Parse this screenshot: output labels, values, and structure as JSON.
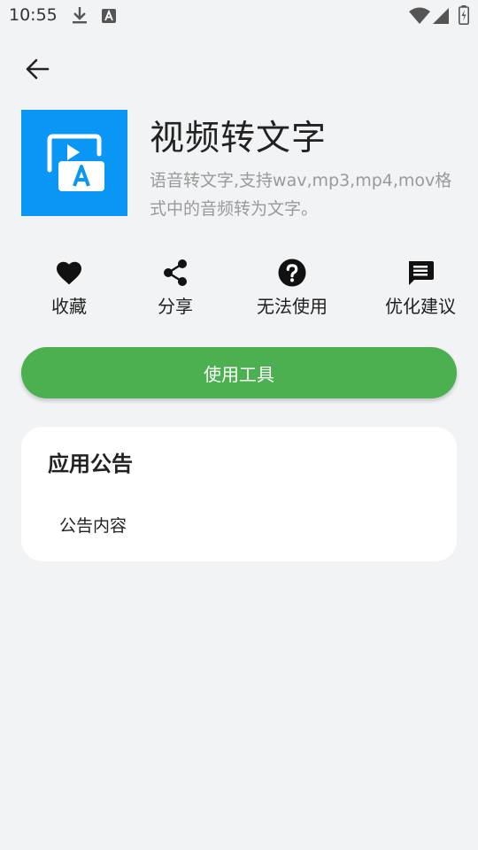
{
  "status_bar": {
    "time": "10:55",
    "icons": [
      "download-icon",
      "text-a-icon",
      "wifi-icon",
      "signal-icon",
      "battery-charging-icon"
    ]
  },
  "nav": {
    "back_icon": "arrow-left-icon"
  },
  "app": {
    "icon": "video-to-text-icon",
    "icon_color": "#0a96f5",
    "title": "视频转文字",
    "description": "语音转文字,支持wav,mp3,mp4,mov格式中的音频转为文字。"
  },
  "actions": [
    {
      "icon": "heart-icon",
      "label": "收藏"
    },
    {
      "icon": "share-icon",
      "label": "分享"
    },
    {
      "icon": "help-icon",
      "label": "无法使用"
    },
    {
      "icon": "message-icon",
      "label": "优化建议"
    }
  ],
  "primary_button": {
    "label": "使用工具",
    "color": "#4caf50"
  },
  "notice": {
    "title": "应用公告",
    "content": "公告内容"
  }
}
